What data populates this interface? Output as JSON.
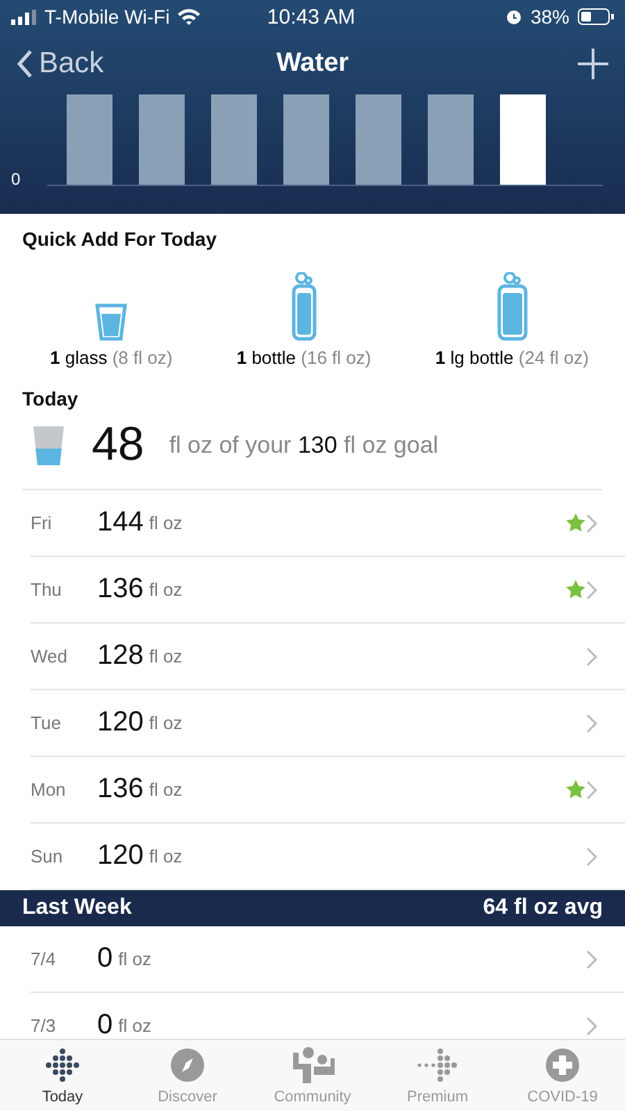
{
  "status_bar": {
    "carrier": "T-Mobile Wi-Fi",
    "time": "10:43 AM",
    "battery": "38%"
  },
  "nav": {
    "back": "Back",
    "title": "Water"
  },
  "chart": {
    "zero_label": "0",
    "bars": [
      {
        "selected": false
      },
      {
        "selected": false
      },
      {
        "selected": false
      },
      {
        "selected": false
      },
      {
        "selected": false
      },
      {
        "selected": false
      },
      {
        "selected": true
      }
    ]
  },
  "quick_add": {
    "title": "Quick Add For Today",
    "items": [
      {
        "kind": "glass",
        "count": "1",
        "name": "glass",
        "size": "(8 fl oz)"
      },
      {
        "kind": "bottle",
        "count": "1",
        "name": "bottle",
        "size": "(16 fl oz)"
      },
      {
        "kind": "large-bottle",
        "count": "1",
        "name": "lg bottle",
        "size": "(24 fl oz)"
      }
    ]
  },
  "today": {
    "title": "Today",
    "amount": "48",
    "goal_text": "fl oz of your **130** fl oz goal"
  },
  "this_week": [
    {
      "day": "Fri",
      "amount": "144",
      "unit": "fl oz",
      "starred": true
    },
    {
      "day": "Thu",
      "amount": "136",
      "unit": "fl oz",
      "starred": true
    },
    {
      "day": "Wed",
      "amount": "128",
      "unit": "fl oz",
      "starred": false
    },
    {
      "day": "Tue",
      "amount": "120",
      "unit": "fl oz",
      "starred": false
    },
    {
      "day": "Mon",
      "amount": "136",
      "unit": "fl oz",
      "starred": true
    },
    {
      "day": "Sun",
      "amount": "120",
      "unit": "fl oz",
      "starred": false
    }
  ],
  "last_week": {
    "title": "Last Week",
    "average": "64 fl oz avg",
    "rows": [
      {
        "day": "7/4",
        "amount": "0",
        "unit": "fl oz",
        "starred": false
      },
      {
        "day": "7/3",
        "amount": "0",
        "unit": "fl oz",
        "starred": false
      }
    ]
  },
  "tab_bar": [
    {
      "kind": "today",
      "label": "Today",
      "selected": true
    },
    {
      "kind": "discover",
      "label": "Discover",
      "selected": false
    },
    {
      "kind": "community",
      "label": "Community",
      "selected": false
    },
    {
      "kind": "premium",
      "label": "Premium",
      "selected": false
    },
    {
      "kind": "covid",
      "label": "COVID-19",
      "selected": false
    }
  ]
}
